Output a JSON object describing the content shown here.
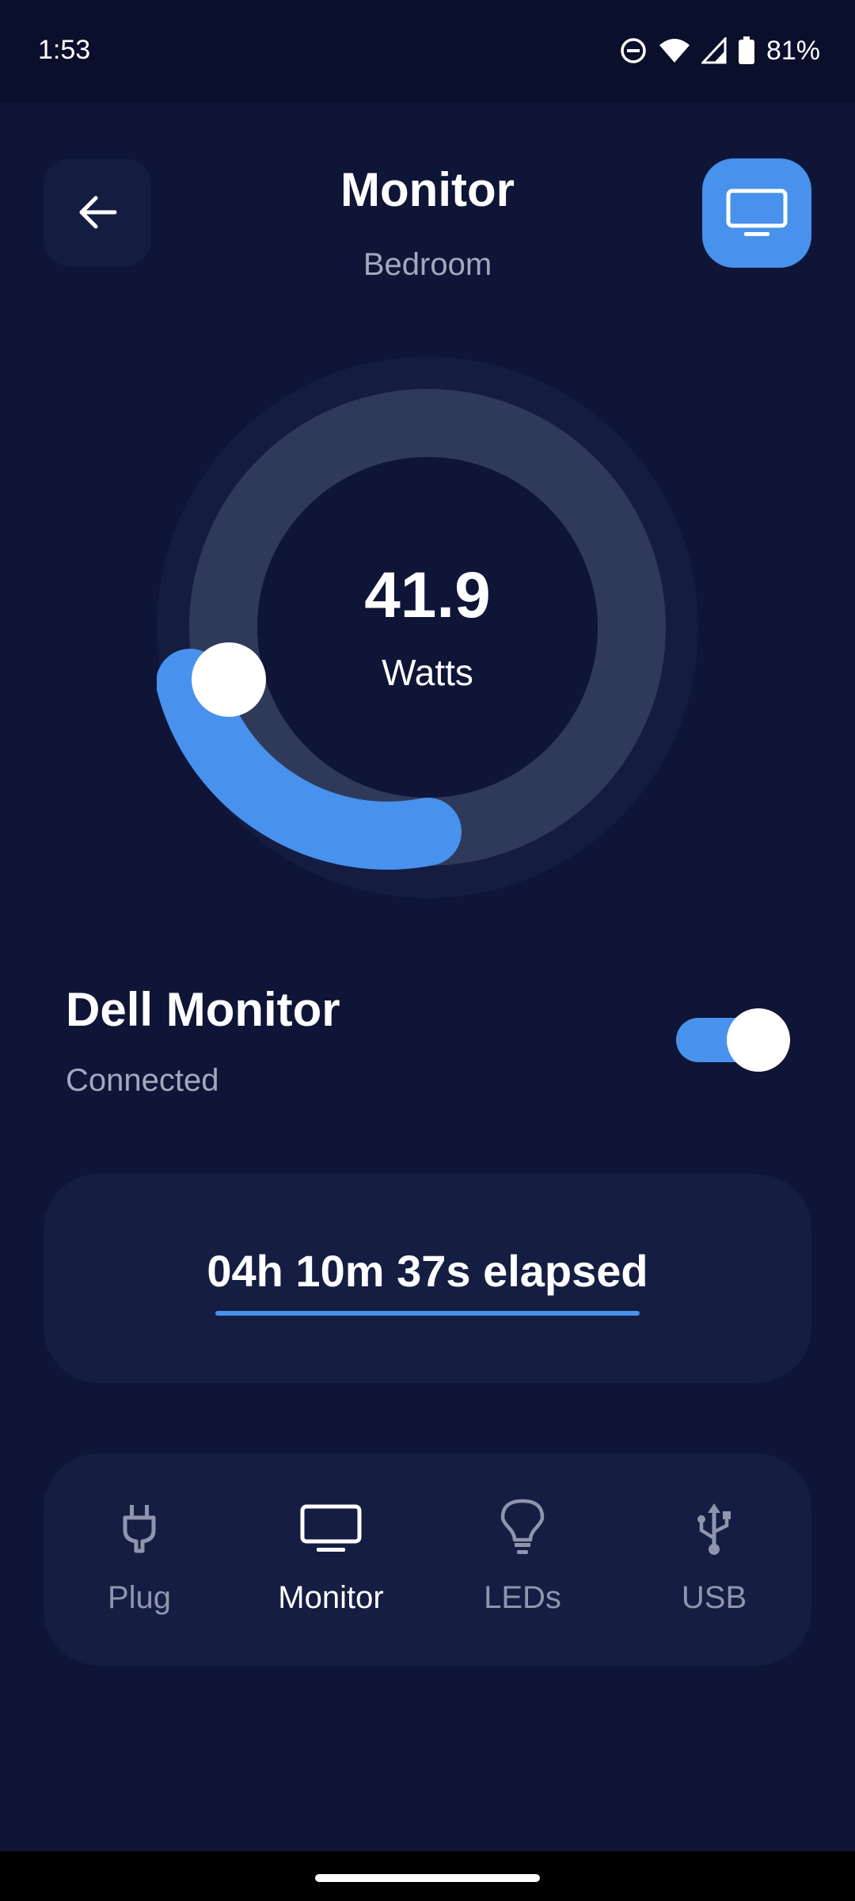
{
  "status_bar": {
    "time": "1:53",
    "battery": "81%",
    "icons": [
      "do-not-disturb-icon",
      "wifi-icon",
      "cellular-signal-icon",
      "battery-icon"
    ]
  },
  "header": {
    "title": "Monitor",
    "subtitle": "Bedroom",
    "back_icon": "arrow-left-icon",
    "device_icon": "monitor-icon"
  },
  "gauge": {
    "value": "41.9",
    "unit": "Watts"
  },
  "device": {
    "name": "Dell Monitor",
    "status": "Connected",
    "power_on": true
  },
  "timer": {
    "text": "04h 10m 37s elapsed"
  },
  "nav": {
    "items": [
      {
        "label": "Plug",
        "icon": "plug-icon",
        "active": false
      },
      {
        "label": "Monitor",
        "icon": "monitor-icon",
        "active": true
      },
      {
        "label": "LEDs",
        "icon": "lightbulb-icon",
        "active": false
      },
      {
        "label": "USB",
        "icon": "usb-icon",
        "active": false
      }
    ]
  },
  "colors": {
    "background": "#0e1537",
    "accent": "#4891ec",
    "card": "#151d42",
    "muted_text": "#a3a8bd"
  }
}
